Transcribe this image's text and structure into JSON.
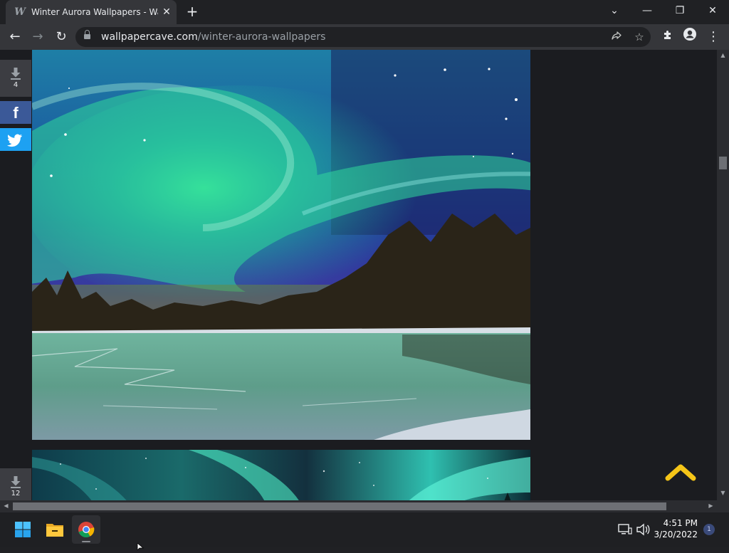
{
  "browser": {
    "tab": {
      "title": "Winter Aurora Wallpapers - Wallpapers",
      "favicon": "W",
      "close_glyph": "✕"
    },
    "new_tab_glyph": "+",
    "window_controls": {
      "tab_search": "⌄",
      "minimize": "—",
      "restore": "❐",
      "close": "✕"
    },
    "toolbar": {
      "back": "←",
      "forward": "→",
      "reload": "↻",
      "menu": "⋮"
    },
    "address": {
      "host": "wallpapercave.com",
      "path": "/winter-aurora-wallpapers"
    }
  },
  "page": {
    "wallpapers": [
      {
        "download_count": "4",
        "icon": "download-icon"
      },
      {
        "download_count": "12",
        "icon": "download-icon"
      }
    ],
    "share": {
      "facebook_glyph": "f",
      "twitter_icon": "twitter-icon"
    },
    "scroll_to_top_color": "#f5c518"
  },
  "taskbar": {
    "apps": [
      "start-icon",
      "file-explorer-icon",
      "chrome-icon"
    ],
    "clock": {
      "time": "4:51 PM",
      "date": "3/20/2022"
    },
    "notification_count": "1"
  }
}
